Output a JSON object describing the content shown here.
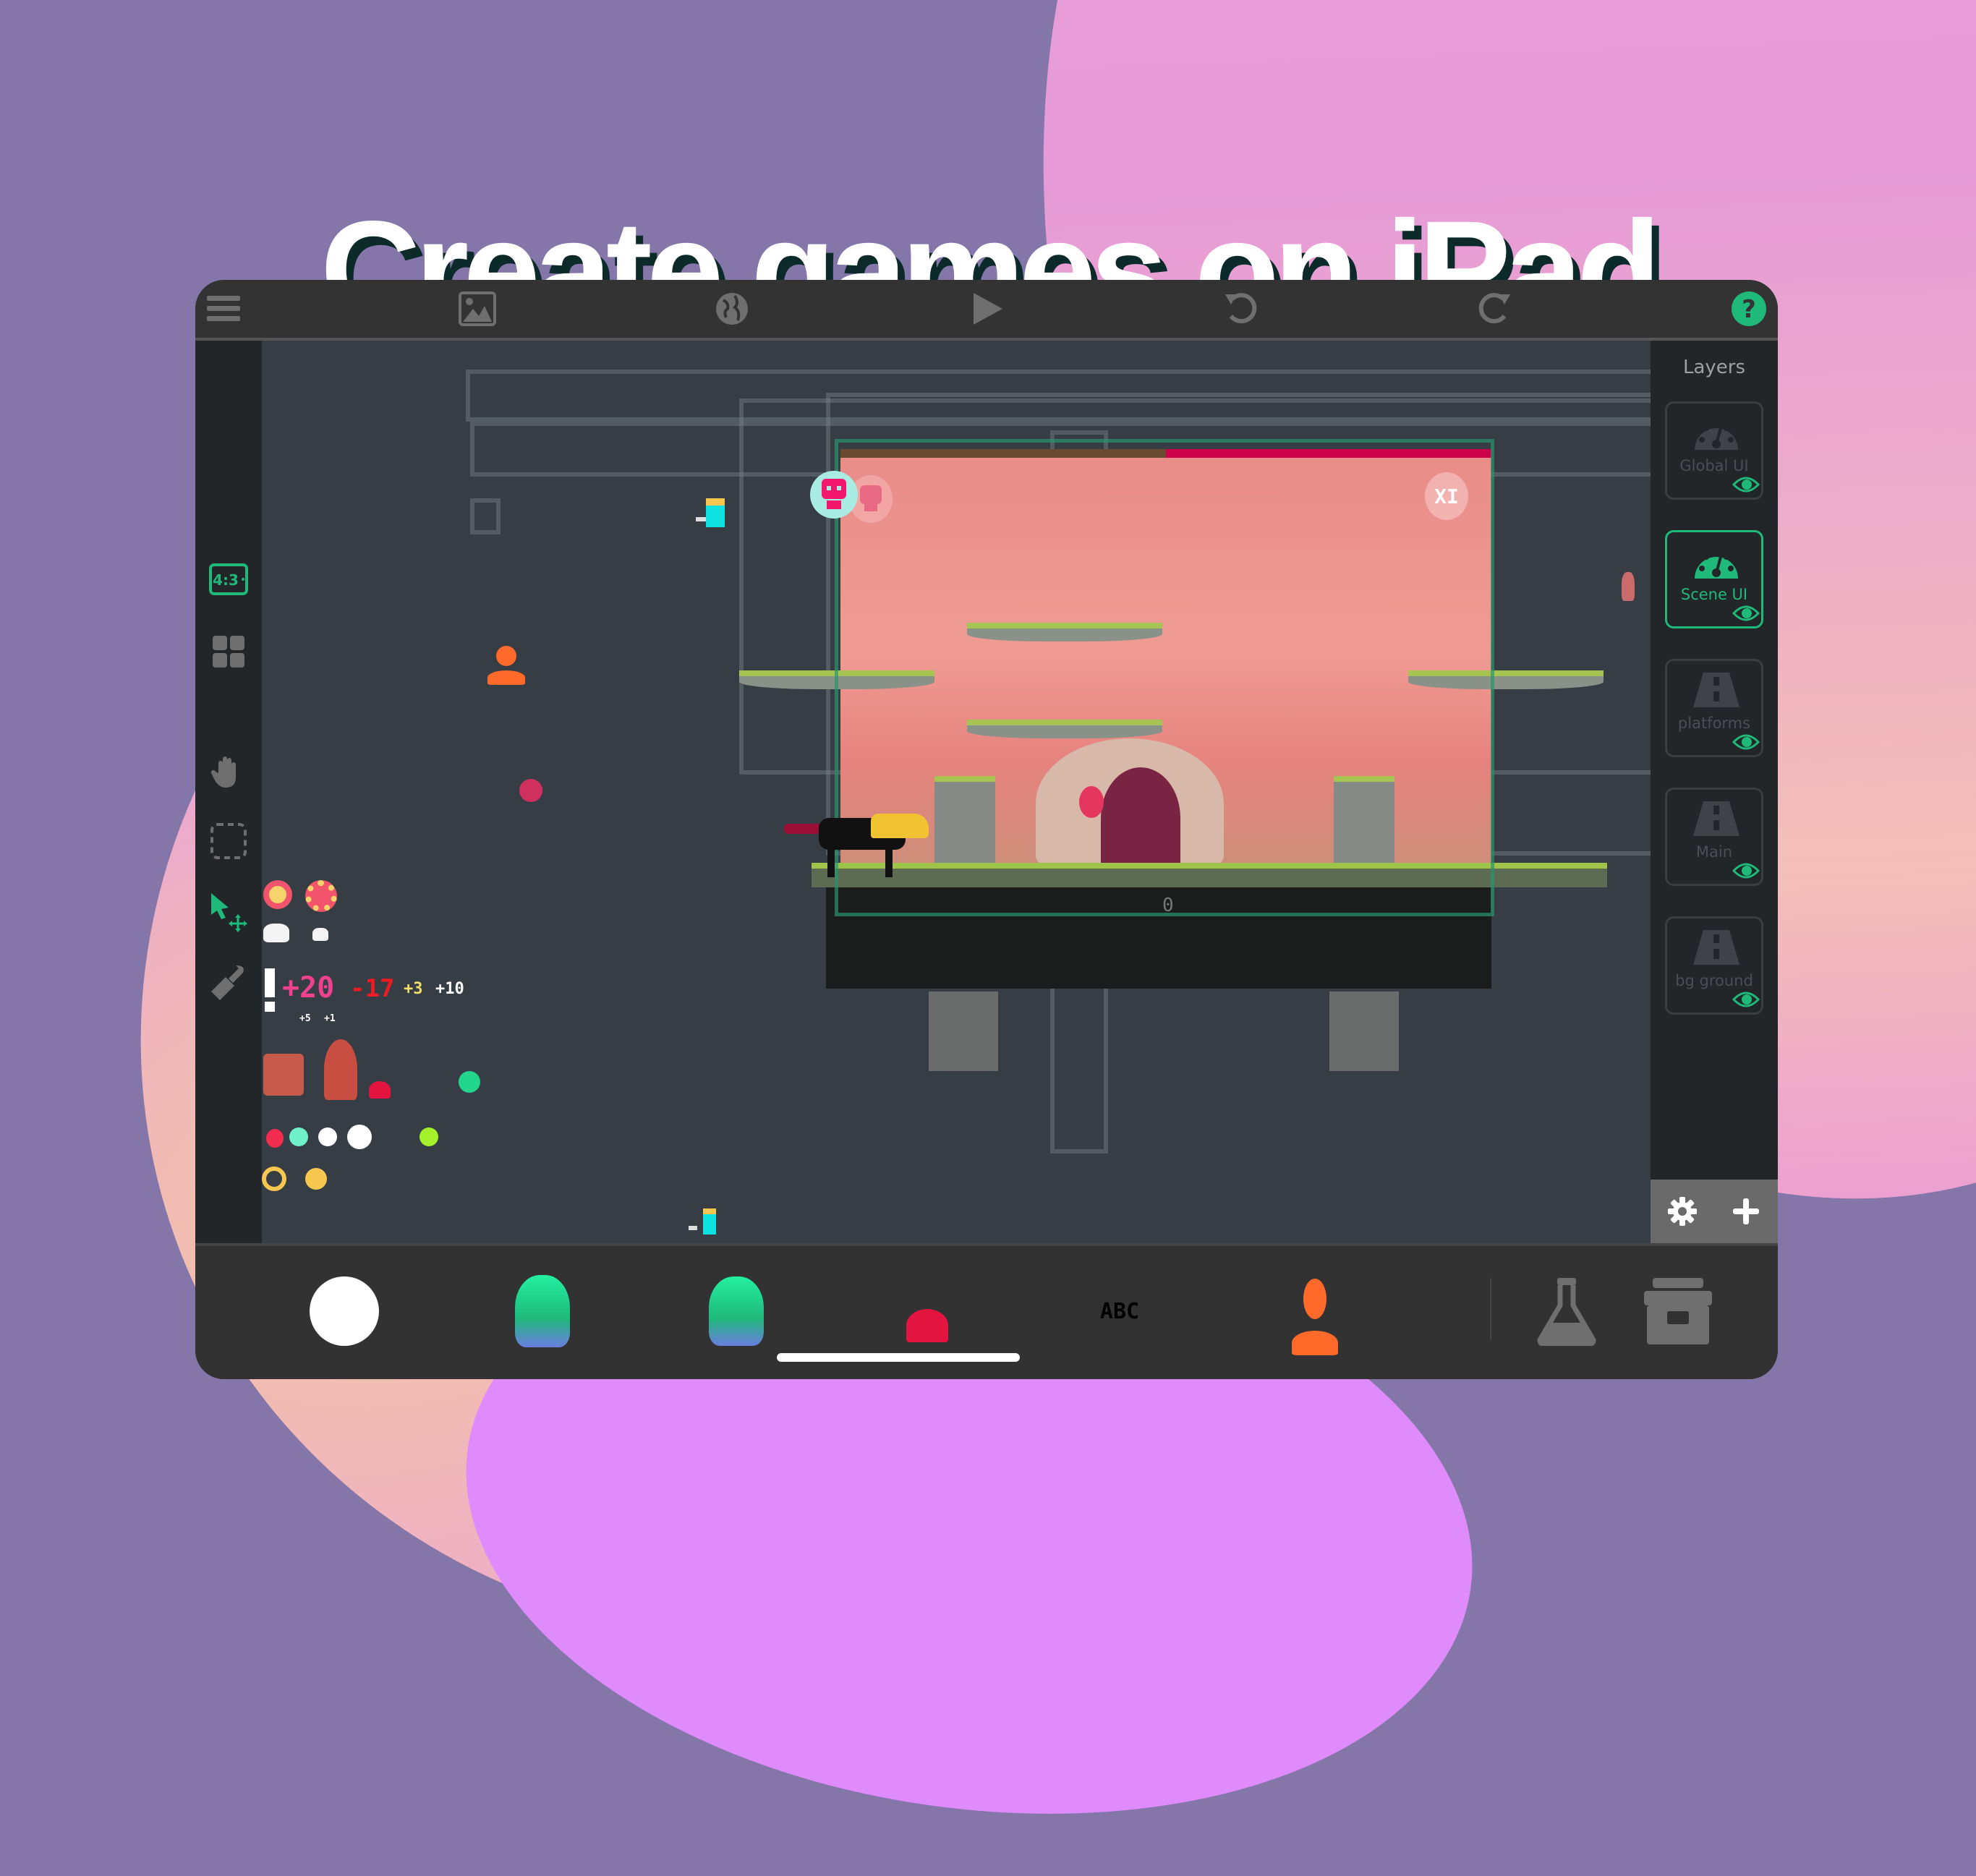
{
  "headline": "Create games on iPad",
  "colors": {
    "accent": "#1fb97a",
    "icon_gray": "#6f6f6f",
    "topbar": "#333333",
    "panel": "#232629",
    "canvas": "#373d45",
    "background": "#8476a9",
    "health_remaining": "#6b4a32",
    "health_lost": "#cc0048"
  },
  "topbar": {
    "buttons": [
      {
        "name": "menu",
        "icon": "hamburger-icon"
      },
      {
        "name": "backgrounds",
        "icon": "image-icon"
      },
      {
        "name": "world",
        "icon": "globe-icon"
      },
      {
        "name": "play",
        "icon": "play-icon"
      },
      {
        "name": "undo",
        "icon": "undo-icon"
      },
      {
        "name": "redo",
        "icon": "redo-icon"
      },
      {
        "name": "help",
        "icon": "help-icon"
      }
    ]
  },
  "left_toolbar": {
    "aspect_ratio_label": "4:3",
    "tools": [
      {
        "name": "aspect-ratio",
        "icon": "tablet-aspect-icon",
        "active": true
      },
      {
        "name": "grid",
        "icon": "grid-icon",
        "active": false
      },
      {
        "name": "pan",
        "icon": "hand-icon",
        "active": false
      },
      {
        "name": "select-area",
        "icon": "dashed-selection-icon",
        "active": false
      },
      {
        "name": "move",
        "icon": "cursor-move-icon",
        "active": true
      },
      {
        "name": "stamp",
        "icon": "stamp-icon",
        "active": false
      }
    ]
  },
  "canvas": {
    "scene": {
      "health_bar_fraction": 0.5,
      "hud_left_icon": "skull-icon",
      "hud_right_label": "XI",
      "score_label": "0"
    },
    "score_popups": [
      {
        "text": "+20",
        "color": "#f0418f"
      },
      {
        "text": "-17",
        "color": "#ee1b24"
      },
      {
        "text": "+3",
        "color": "#f3e06a"
      },
      {
        "text": "+10",
        "color": "#ffffff"
      },
      {
        "text": "+5",
        "color": "#ffffff"
      },
      {
        "text": "+1",
        "color": "#ffffff"
      }
    ],
    "color_dots": [
      "#f22c4e",
      "#6ff2c9",
      "#ffffff",
      "#ffffff",
      "#a3f12a"
    ],
    "ring_colors": [
      "#f7c74f",
      "#f7c74f"
    ]
  },
  "layers_panel": {
    "title": "Layers",
    "layers": [
      {
        "label": "Global UI",
        "icon": "gauge-icon",
        "active": false,
        "visible": true
      },
      {
        "label": "Scene UI",
        "icon": "gauge-icon",
        "active": true,
        "visible": true
      },
      {
        "label": "platforms",
        "icon": "road-icon",
        "active": false,
        "visible": true
      },
      {
        "label": "Main",
        "icon": "road-icon",
        "active": false,
        "visible": true
      },
      {
        "label": "bg ground",
        "icon": "road-icon",
        "active": false,
        "visible": true
      }
    ],
    "footer": [
      {
        "name": "layer-settings",
        "icon": "gear-icon"
      },
      {
        "name": "add-layer",
        "icon": "plus-icon"
      }
    ]
  },
  "object_palette": {
    "items": [
      {
        "name": "white-ball",
        "icon": "white-circle-sprite"
      },
      {
        "name": "green-ghost-1",
        "icon": "green-ghost-sprite"
      },
      {
        "name": "green-ghost-2",
        "icon": "green-ghost-sprite"
      },
      {
        "name": "red-slime",
        "icon": "red-slime-sprite"
      },
      {
        "name": "text-object",
        "label": "ABC"
      },
      {
        "name": "fire-torch",
        "icon": "fire-sprite"
      }
    ],
    "actions": [
      {
        "name": "behaviors-lab",
        "icon": "flask-icon"
      },
      {
        "name": "object-library",
        "icon": "archive-box-icon"
      }
    ]
  }
}
